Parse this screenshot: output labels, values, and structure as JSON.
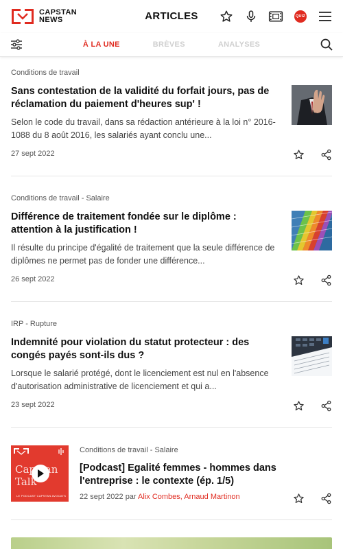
{
  "app": {
    "brand_line1": "CAPSTAN",
    "brand_line2": "NEWS",
    "page_title": "ARTICLES",
    "quiz_label": "QUIZ",
    "accent_color": "#e02b20"
  },
  "tabs": [
    {
      "label": "À LA UNE",
      "active": true
    },
    {
      "label": "BRÈVES",
      "active": false
    },
    {
      "label": "ANALYSES",
      "active": false
    }
  ],
  "icons": {
    "header": [
      "favorites-icon",
      "microphone-icon",
      "video-icon",
      "quiz-icon",
      "menu-icon"
    ],
    "tabbar": [
      "filter-icon",
      "search-icon"
    ],
    "article_actions": [
      "bookmark-icon",
      "share-icon"
    ]
  },
  "articles": [
    {
      "category": "Conditions de travail",
      "title": "Sans contestation de la validité du forfait jours, pas de réclamation du paiement d'heures sup' !",
      "excerpt": "Selon le code du travail, dans sa rédaction antérieure à la loi n° 2016-1088 du 8 août 2016, les salariés ayant conclu une...",
      "date": "27 sept 2022",
      "thumbnail": "man-in-suit-stop-hand"
    },
    {
      "category": "Conditions de travail - Salaire",
      "title": "Différence de traitement fondée sur le diplôme : attention à la justification !",
      "excerpt": "Il résulte du principe d'égalité de traitement que la seule différence de diplômes ne permet pas de fonder une différence...",
      "date": "26 sept 2022",
      "thumbnail": "colorful-glass-building"
    },
    {
      "category": "IRP - Rupture",
      "title": "Indemnité pour violation du statut protecteur : des congés payés sont-ils dus ?",
      "excerpt": "Lorsque le salarié protégé, dont le licenciement est nul en l'absence d'autorisation administrative de licenciement et qui a...",
      "date": "23 sept 2022",
      "thumbnail": "calculator-and-documents"
    }
  ],
  "podcast": {
    "category": "Conditions de travail - Salaire",
    "title": "[Podcast] Egalité femmes - hommes dans l'entreprise : le contexte (ép. 1/5)",
    "date": "22 sept 2022",
    "by": "par",
    "authors": "Alix Combes, Arnaud Martinon",
    "cover_title": "Capstan Talk",
    "cover_subtitle": "LE PODCAST CAPSTAN AVOCATS"
  }
}
